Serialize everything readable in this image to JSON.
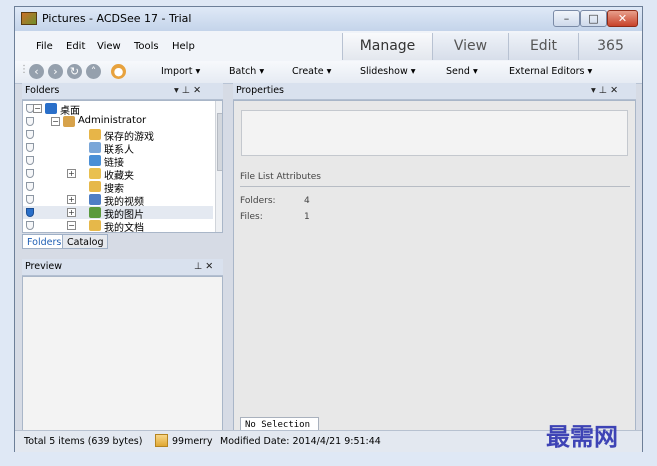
{
  "window": {
    "title": "Pictures - ACDSee 17 - Trial",
    "controls": {
      "minimize": "–",
      "maximize": "□",
      "close": "✕"
    }
  },
  "menu": [
    "File",
    "Edit",
    "View",
    "Tools",
    "Help"
  ],
  "modes": [
    "Manage",
    "View",
    "Edit",
    "365"
  ],
  "active_mode": "Manage",
  "toolbar": {
    "nav_icons": [
      "back-icon",
      "forward-icon",
      "up-icon",
      "home-icon"
    ],
    "items": [
      "Import ▾",
      "Batch ▾",
      "Create ▾",
      "Slideshow ▾",
      "Send ▾",
      "External Editors ▾"
    ]
  },
  "folders_panel": {
    "title": "Folders",
    "controls": "▾ ⊥ ✕",
    "tree": [
      {
        "label": "桌面",
        "expander": "−",
        "icon": "desktop-icon",
        "color": "#2a6fc9"
      },
      {
        "label": "Administrator",
        "expander": "−",
        "icon": "user-folder-icon",
        "color": "#d7a24a"
      },
      {
        "label": "保存的游戏",
        "expander": "",
        "icon": "games-folder-icon",
        "color": "#e7b548"
      },
      {
        "label": "联系人",
        "expander": "",
        "icon": "contacts-folder-icon",
        "color": "#7aa6d8"
      },
      {
        "label": "链接",
        "expander": "",
        "icon": "links-folder-icon",
        "color": "#4a8fd6"
      },
      {
        "label": "收藏夹",
        "expander": "+",
        "icon": "favorites-folder-icon",
        "color": "#e9c04f"
      },
      {
        "label": "搜索",
        "expander": "",
        "icon": "search-folder-icon",
        "color": "#e6b84a"
      },
      {
        "label": "我的视频",
        "expander": "+",
        "icon": "videos-folder-icon",
        "color": "#4f7ec4"
      },
      {
        "label": "我的图片",
        "expander": "+",
        "icon": "pictures-folder-icon",
        "color": "#5a9a3c"
      },
      {
        "label": "我的文档",
        "expander": "−",
        "icon": "documents-folder-icon",
        "color": "#e6b84a"
      }
    ],
    "tabs": [
      "Folders",
      "Catalog"
    ]
  },
  "preview_panel": {
    "title": "Preview",
    "controls": "⊥ ✕"
  },
  "properties_panel": {
    "title": "Properties",
    "controls": "▾ ⊥ ✕",
    "section_title": "File List Attributes",
    "folders_label": "Folders:",
    "folders_value": "4",
    "files_label": "Files:",
    "files_value": "1",
    "selection_tab": "No Selection"
  },
  "status": {
    "total": "Total 5 items (639 bytes)",
    "folder": "99merry",
    "modified": "Modified Date: 2014/4/21 9:51:44"
  },
  "watermark": "最需网"
}
